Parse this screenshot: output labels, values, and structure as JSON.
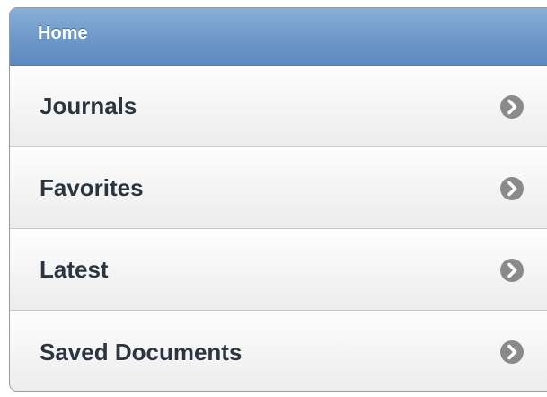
{
  "header": {
    "title": "Home"
  },
  "items": [
    {
      "label": "Journals",
      "icon": "chevron-right-icon"
    },
    {
      "label": "Favorites",
      "icon": "chevron-right-icon"
    },
    {
      "label": "Latest",
      "icon": "chevron-right-icon"
    },
    {
      "label": "Saved Documents",
      "icon": "chevron-right-icon"
    }
  ],
  "colors": {
    "header": "#6d98c8",
    "label": "#2b3540",
    "icon": "#8a8a8a"
  }
}
